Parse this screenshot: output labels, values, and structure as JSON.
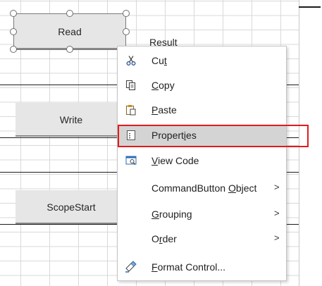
{
  "sheet": {
    "buttons": [
      {
        "label": "Read"
      },
      {
        "label": "Write"
      },
      {
        "label": "ScopeStart"
      }
    ],
    "result_label": "Result"
  },
  "context_menu": {
    "items": [
      {
        "pre": "Cu",
        "u": "t",
        "post": "",
        "icon": "scissors-icon"
      },
      {
        "pre": "",
        "u": "C",
        "post": "opy",
        "icon": "copy-icon"
      },
      {
        "pre": "",
        "u": "P",
        "post": "aste",
        "icon": "paste-icon"
      },
      {
        "pre": "Propert",
        "u": "i",
        "post": "es",
        "icon": "properties-icon",
        "highlighted": true
      },
      {
        "pre": "",
        "u": "V",
        "post": "iew Code",
        "icon": "view-code-icon"
      },
      {
        "pre": "CommandButton ",
        "u": "O",
        "post": "bject",
        "submenu": true
      },
      {
        "pre": "",
        "u": "G",
        "post": "rouping",
        "submenu": true
      },
      {
        "pre": "O",
        "u": "r",
        "post": "der",
        "submenu": true
      },
      {
        "pre": "",
        "u": "F",
        "post": "ormat Control...",
        "icon": "format-control-icon"
      }
    ],
    "submenu_glyph": ">"
  },
  "colors": {
    "highlight_outline": "#e21b1b",
    "menu_hover": "#d4d4d4",
    "button_face": "#e6e6e6"
  }
}
